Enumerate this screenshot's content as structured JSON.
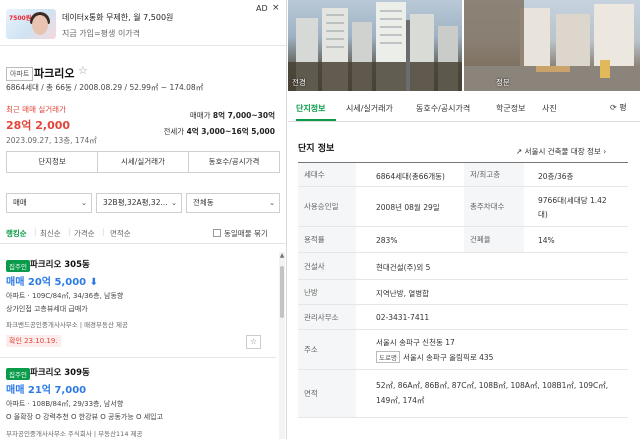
{
  "ad": {
    "title": "데이터x통화 무제한, 월 7,500원",
    "subtitle": "지금 가입=평생 이가격",
    "badge": "AD",
    "close": "×",
    "thumb_price": "7500원"
  },
  "complex": {
    "type_tag": "아파트",
    "name": "파크리오",
    "star": "☆",
    "meta": "6864세대 / 총 66동 / 2008.08.29 / 52.99㎡ ~ 174.08㎡",
    "recent_label": "최근 매매 실거래가",
    "recent_price": "28억 2,000",
    "recent_date": "2023.09.27, 13층, 174㎡",
    "sale_label": "매매가",
    "sale_range": "8억 7,000~30억",
    "jeonse_label": "전세가",
    "jeonse_range": "4억 3,000~16억 5,000"
  },
  "left_tabs": [
    "단지정보",
    "시세/실거래가",
    "동호수/공시가격"
  ],
  "filters": {
    "trade_type": "매매",
    "area": "32B평,32A평,32...",
    "building": "전체동",
    "chevron": "⌄"
  },
  "sort": {
    "items": [
      "랭킹순",
      "최신순",
      "가격순",
      "면적순"
    ],
    "group_toggle": "동일매물 묶기"
  },
  "listings": [
    {
      "tag": "집주인",
      "name": "파크리오 305동",
      "price": "매매 20억 5,000",
      "price_arrow": "⬇",
      "detail": "아파트 · 109C/84㎡, 34/36층, 남동향",
      "desc": "상가인접 고층뷰세대 급매가",
      "agency": "파크밴드공인중개사사무소 | 매경부동산 제공",
      "confirm": "확인 23.10.19.",
      "fav": "☆"
    },
    {
      "tag": "집주인",
      "name": "파크리오 309동",
      "price": "매매 21억 7,000",
      "detail": "아파트 · 108B/84㎡, 29/33층, 남서향",
      "desc": "O 올확장 O 강력추천 O 한강뷰 O 공동가능 O 세입고",
      "agency": "부자공인중개사사무소 주식회사 | 부동산114 제공"
    }
  ],
  "photos": {
    "left_caption": "전경",
    "right_caption": "정문"
  },
  "right_tabs": [
    "단지정보",
    "시세/실거래가",
    "동호수/공시가격",
    "학군정보",
    "사진"
  ],
  "right_tab_more": "⟳ 평",
  "detail": {
    "title": "단지 정보",
    "link": "↗ 서울시 건축물 대장 정보 ›",
    "rows": {
      "households_label": "세대수",
      "households": "6864세대(총66개동)",
      "floors_label": "저/최고층",
      "floors": "20층/36층",
      "approval_label": "사용승인일",
      "approval": "2008년 08월 29일",
      "parking_label": "총주차대수",
      "parking_1": "9766대(세대당 1.42",
      "parking_2": "대)",
      "far_label": "용적률",
      "far": "283%",
      "bcr_label": "건폐율",
      "bcr": "14%",
      "builder_label": "건설사",
      "builder": "현대건설(주)외 5",
      "heating_label": "난방",
      "heating": "지역난방, 열병합",
      "office_label": "관리사무소",
      "office": "02-3431-7411",
      "address_label": "주소",
      "address": "서울시 송파구 신천동 17",
      "road_tag": "도로명",
      "road_address": "서울시 송파구 올림픽로 435",
      "area_label": "면적",
      "area_1": "52㎡, 86A㎡, 86B㎡, 87C㎡, 108B㎡, 108A㎡, 108B1㎡, 109C㎡,",
      "area_2": "149㎡, 174㎡"
    }
  }
}
